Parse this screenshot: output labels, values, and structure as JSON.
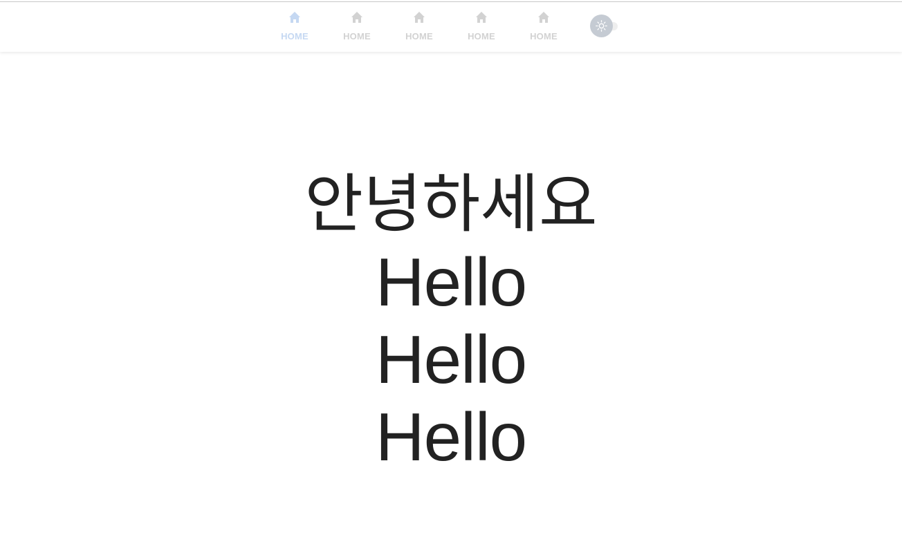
{
  "nav": {
    "items": [
      {
        "label": "HOME",
        "icon": "home-icon",
        "active": true
      },
      {
        "label": "HOME",
        "icon": "home-icon",
        "active": false
      },
      {
        "label": "HOME",
        "icon": "home-icon",
        "active": false
      },
      {
        "label": "HOME",
        "icon": "home-icon",
        "active": false
      },
      {
        "label": "HOME",
        "icon": "home-icon",
        "active": false
      }
    ],
    "theme_toggle": {
      "icon": "sun-icon",
      "state": "light"
    }
  },
  "main": {
    "greeting": "안녕하세요",
    "lines": [
      "Hello",
      "Hello",
      "Hello"
    ]
  },
  "colors": {
    "active_nav": "#c5d8f2",
    "inactive_nav": "#d2d2d2",
    "text": "#222222",
    "toggle_knob": "#c5cbd3"
  }
}
